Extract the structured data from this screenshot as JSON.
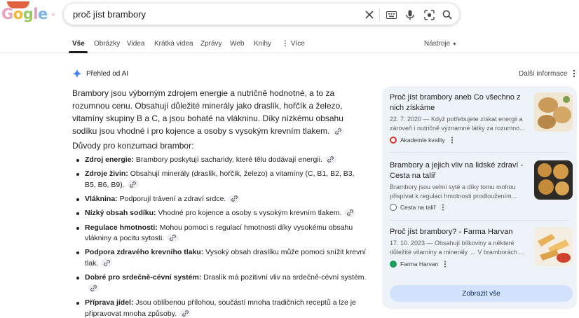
{
  "logo": {
    "letters": [
      "G",
      "o",
      "g",
      "l",
      "e"
    ]
  },
  "search": {
    "query": "proč jíst brambory"
  },
  "tabs": [
    {
      "label": "Vše",
      "active": true
    },
    {
      "label": "Obrázky"
    },
    {
      "label": "Videa"
    },
    {
      "label": "Krátká videa"
    },
    {
      "label": "Zprávy"
    },
    {
      "label": "Web"
    },
    {
      "label": "Knihy"
    },
    {
      "label": "Více"
    }
  ],
  "tools_label": "Nástroje",
  "ai_overview": {
    "title": "Přehled od AI",
    "more_info": "Další informace",
    "summary": "Brambory jsou výborným zdrojem energie a nutričně hodnotné, a to za rozumnou cenu. Obsahují důležité minerály jako draslík, hořčík a železo, vitamíny skupiny B a C, a jsou bohaté na vlákninu. Díky nízkému obsahu sodíku jsou vhodné i pro kojence a osoby s vysokým krevním tlakem.",
    "reasons_title": "Důvody pro konzumaci brambor:",
    "reasons": [
      {
        "term": "Zdroj energie:",
        "text": " Brambory poskytují sacharidy, které tělu dodávají energii."
      },
      {
        "term": "Zdroje živin:",
        "text": " Obsahují minerály (draslík, hořčík, železo) a vitamíny (C, B1, B2, B3, B5, B6, B9)."
      },
      {
        "term": "Vláknina:",
        "text": " Podporují trávení a zdraví srdce."
      },
      {
        "term": "Nízký obsah sodíku:",
        "text": " Vhodné pro kojence a osoby s vysokým krevním tlakem."
      },
      {
        "term": "Regulace hmotnosti:",
        "text": " Mohou pomoci s regulací hmotnosti díky vysokému obsahu vlákniny a pocitu sytosti."
      },
      {
        "term": "Podpora zdravého krevního tlaku:",
        "text": " Vysoký obsah draslíku může pomoci snížit krevní tlak."
      },
      {
        "term": "Dobré pro srdečně-cévní systém:",
        "text": " Draslík má pozitivní vliv na srdečně-cévní systém."
      },
      {
        "term": "Příprava jídel:",
        "text": " Jsou oblíbenou přílohou, součástí mnoha tradičních receptů a lze je připravovat mnoha způsoby."
      }
    ]
  },
  "sources": [
    {
      "title": "Proč jíst brambory aneb Co všechno z nich získáme",
      "snippet": "22. 7. 2020 — Když potřebujete získat energii a zároveň i nutričně významné látky za rozumno...",
      "site": "Akademie kvality",
      "favicon_color": "#d93025"
    },
    {
      "title": "Brambory a jejich vliv na lidské zdraví - Cesta na talíř",
      "snippet": "Brambory jsou velmi syté a díky tomu mohou přispívat k regulaci hmotnosti prodloužením...",
      "site": "Cesta na talíř",
      "favicon_color": "#5f6368"
    },
    {
      "title": "Proč jíst brambory? - Farma Harvan",
      "snippet": "17. 10. 2023 — Obsahují bílkoviny a některé důležité vitamíny a minerály. ... V bramborách ...",
      "site": "Farma Harvan",
      "favicon_color": "#1a9c5a"
    }
  ],
  "show_all": "Zobrazit vše"
}
